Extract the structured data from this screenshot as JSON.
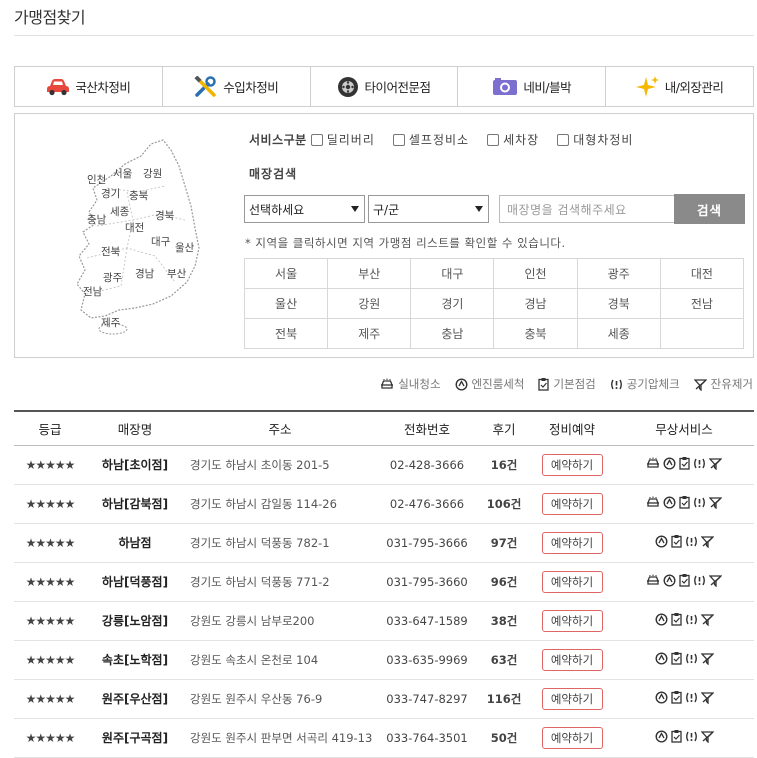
{
  "page": {
    "title": "가맹점찾기"
  },
  "categories": [
    {
      "label": "국산차정비",
      "icon": "car-icon"
    },
    {
      "label": "수입차정비",
      "icon": "tools-icon"
    },
    {
      "label": "타이어전문점",
      "icon": "tire-icon"
    },
    {
      "label": "네비/블박",
      "icon": "camera-icon"
    },
    {
      "label": "내/외장관리",
      "icon": "sparkle-icon"
    }
  ],
  "map": {
    "regions": [
      "서울",
      "인천",
      "강원",
      "경기",
      "충북",
      "세종",
      "충남",
      "경북",
      "대전",
      "대구",
      "울산",
      "전북",
      "광주",
      "경남",
      "부산",
      "전남",
      "제주"
    ]
  },
  "filters": {
    "service_label": "서비스구분",
    "services": [
      "딜리버리",
      "셀프정비소",
      "세차장",
      "대형차정비"
    ],
    "store_search_label": "매장검색",
    "city_select": "선택하세요",
    "gu_select": "구/군",
    "name_placeholder": "매장명을 검색해주세요",
    "search_button": "검색",
    "region_note": "* 지역을 클릭하시면 지역 가맹점 리스트를 확인할 수 있습니다.",
    "region_grid": [
      [
        "서울",
        "부산",
        "대구",
        "인천",
        "광주",
        "대전"
      ],
      [
        "울산",
        "강원",
        "경기",
        "경남",
        "경북",
        "전남"
      ],
      [
        "전북",
        "제주",
        "충남",
        "충북",
        "세종",
        ""
      ]
    ]
  },
  "legend": [
    {
      "label": "실내청소",
      "icon": "car-wash-icon"
    },
    {
      "label": "엔진룸세척",
      "icon": "engine-wash-icon"
    },
    {
      "label": "기본점검",
      "icon": "checklist-icon"
    },
    {
      "label": "공기압체크",
      "icon": "tire-pressure-icon"
    },
    {
      "label": "잔유제거",
      "icon": "residue-removal-icon"
    }
  ],
  "table": {
    "headers": [
      "등급",
      "매장명",
      "주소",
      "전화번호",
      "후기",
      "정비예약",
      "무상서비스"
    ],
    "book_label": "예약하기",
    "rows": [
      {
        "rating": "★★★★★",
        "name": "하남[초이점]",
        "address": "경기도 하남시 초이동 201-5",
        "phone": "02-428-3666",
        "reviews": "16건",
        "services": [
          "car-wash",
          "engine-wash",
          "checklist",
          "tire-pressure",
          "residue"
        ]
      },
      {
        "rating": "★★★★★",
        "name": "하남[감북점]",
        "address": "경기도 하남시 감일동 114-26",
        "phone": "02-476-3666",
        "reviews": "106건",
        "services": [
          "car-wash",
          "engine-wash",
          "checklist",
          "tire-pressure",
          "residue"
        ]
      },
      {
        "rating": "★★★★★",
        "name": "하남점",
        "address": "경기도 하남시 덕풍동 782-1",
        "phone": "031-795-3666",
        "reviews": "97건",
        "services": [
          "engine-wash",
          "checklist",
          "tire-pressure",
          "residue"
        ]
      },
      {
        "rating": "★★★★★",
        "name": "하남[덕풍점]",
        "address": "경기도 하남시 덕풍동 771-2",
        "phone": "031-795-3660",
        "reviews": "96건",
        "services": [
          "car-wash",
          "engine-wash",
          "checklist",
          "tire-pressure",
          "residue"
        ]
      },
      {
        "rating": "★★★★★",
        "name": "강릉[노암점]",
        "address": "강원도 강릉시 남부로200",
        "phone": "033-647-1589",
        "reviews": "38건",
        "services": [
          "engine-wash",
          "checklist",
          "tire-pressure",
          "residue"
        ]
      },
      {
        "rating": "★★★★★",
        "name": "속초[노학점]",
        "address": "강원도 속초시 온천로 104",
        "phone": "033-635-9969",
        "reviews": "63건",
        "services": [
          "engine-wash",
          "checklist",
          "tire-pressure",
          "residue"
        ]
      },
      {
        "rating": "★★★★★",
        "name": "원주[우산점]",
        "address": "강원도 원주시 우산동 76-9",
        "phone": "033-747-8297",
        "reviews": "116건",
        "services": [
          "engine-wash",
          "checklist",
          "tire-pressure",
          "residue"
        ]
      },
      {
        "rating": "★★★★★",
        "name": "원주[구곡점]",
        "address": "강원도 원주시 판부면 서곡리 419-13",
        "phone": "033-764-3501",
        "reviews": "50건",
        "services": [
          "engine-wash",
          "checklist",
          "tire-pressure",
          "residue"
        ]
      }
    ]
  },
  "colors": {
    "accent": "#e06666",
    "star": "#f2b01e",
    "review": "#f0a020",
    "search_button": "#8a8a8a"
  }
}
